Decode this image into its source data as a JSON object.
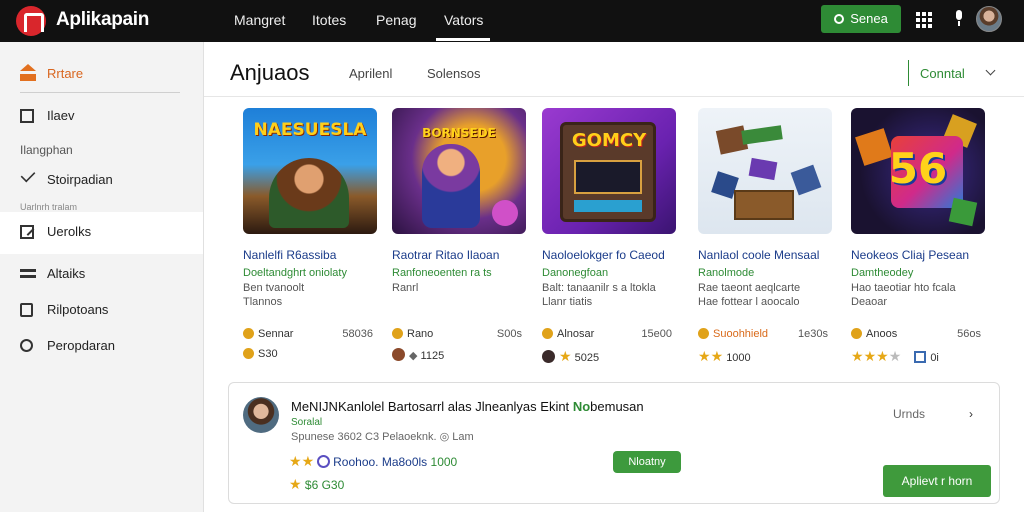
{
  "topbar": {
    "app_name": "Aplikapain",
    "nav": [
      "Mangret",
      "Itotes",
      "Penag",
      "Vators"
    ],
    "active_nav": "Vators",
    "cta_label": "Senea",
    "colors": {
      "bar": "#111111",
      "cta": "#2e8b35"
    }
  },
  "sidebar": {
    "items": [
      {
        "label": "Rrtare",
        "icon": "home-icon",
        "active": true
      },
      {
        "label": "Ilaev",
        "icon": "square-icon"
      },
      {
        "label": "Stoirpadian",
        "icon": "chevron-icon"
      },
      {
        "label": "Uerolks",
        "icon": "edit-icon",
        "highlighted": true
      },
      {
        "label": "Altaiks",
        "icon": "library-icon"
      },
      {
        "label": "Rilpotoans",
        "icon": "tag-icon"
      },
      {
        "label": "Peropdaran",
        "icon": "pin-icon"
      }
    ],
    "section_label": "Ilangphan",
    "section_label_2": "Uarlnrh tralam"
  },
  "header": {
    "title": "Anjuaos",
    "tabs": [
      "Aprilenl",
      "Solensos"
    ],
    "control_label": "Conntal"
  },
  "cards": [
    {
      "thumb_text": "NAESUESLA",
      "title": "Nanlelfi R6assiba",
      "subtitle": "Doeltandghrt oniolaty",
      "desc1": "Ben tvanoolt",
      "desc2": "Tlannos",
      "meta_label": "Sennar",
      "meta_count": "58036",
      "rating_text": "S30",
      "rating_prefix": "",
      "stars": 0
    },
    {
      "thumb_text": "BORNSEDE",
      "title": "Raotrar Ritao Ilaoan",
      "subtitle": "Ranfoneoenten ra ts",
      "desc1": "Ranrl",
      "desc2": "",
      "meta_label": "Rano",
      "meta_count": "S00s",
      "rating_text": "1125",
      "rating_prefix": "",
      "stars": 0
    },
    {
      "thumb_text": "GOMCY",
      "title": "Naoloelokger fo Caeod",
      "subtitle": "Danonegfoan",
      "desc1": "Balt: tanaanilr s a ltokla",
      "desc2": "Llanr tiatis",
      "meta_label": "Alnosar",
      "meta_count": "15e00",
      "rating_text": "5025",
      "rating_prefix": "",
      "stars": 1
    },
    {
      "thumb_text": "",
      "title": "Nanlaol coole Mensaal",
      "subtitle": "Ranolmode",
      "desc1": "Rae taeont aeqlcarte",
      "desc2": "Hae fottear l aoocalo",
      "meta_label": "Suoohhield",
      "meta_count": "1e30s",
      "rating_text": "1000",
      "rating_prefix": "",
      "stars": 2
    },
    {
      "thumb_text": "56",
      "title": "Neokeos Cliaj Pesean",
      "subtitle": "Damtheodey",
      "desc1": "Hao taeotiar hto fcala",
      "desc2": "Deaoar",
      "meta_label": "Anoos",
      "meta_count": "56os",
      "rating_text": "0i",
      "rating_prefix": "",
      "stars": 4
    }
  ],
  "panel": {
    "title": "MeNIJNKanlolel Bartosarrl alas Jlneanlyas Ekint",
    "title_accent": "No",
    "title_end": "bemusan",
    "subtitle": "Soralal",
    "meta": "Spunese 3602  C3 Pelaoeknk.  ◎  Lam",
    "row1_info": "Roohoo. Ma8o0ls",
    "row1_value": "1000",
    "row2_value": "$6 G30",
    "pill_label": "Nloatny",
    "side_label": "Urnds",
    "side_chevron": "›",
    "button_label": "Aplievt r horn"
  }
}
